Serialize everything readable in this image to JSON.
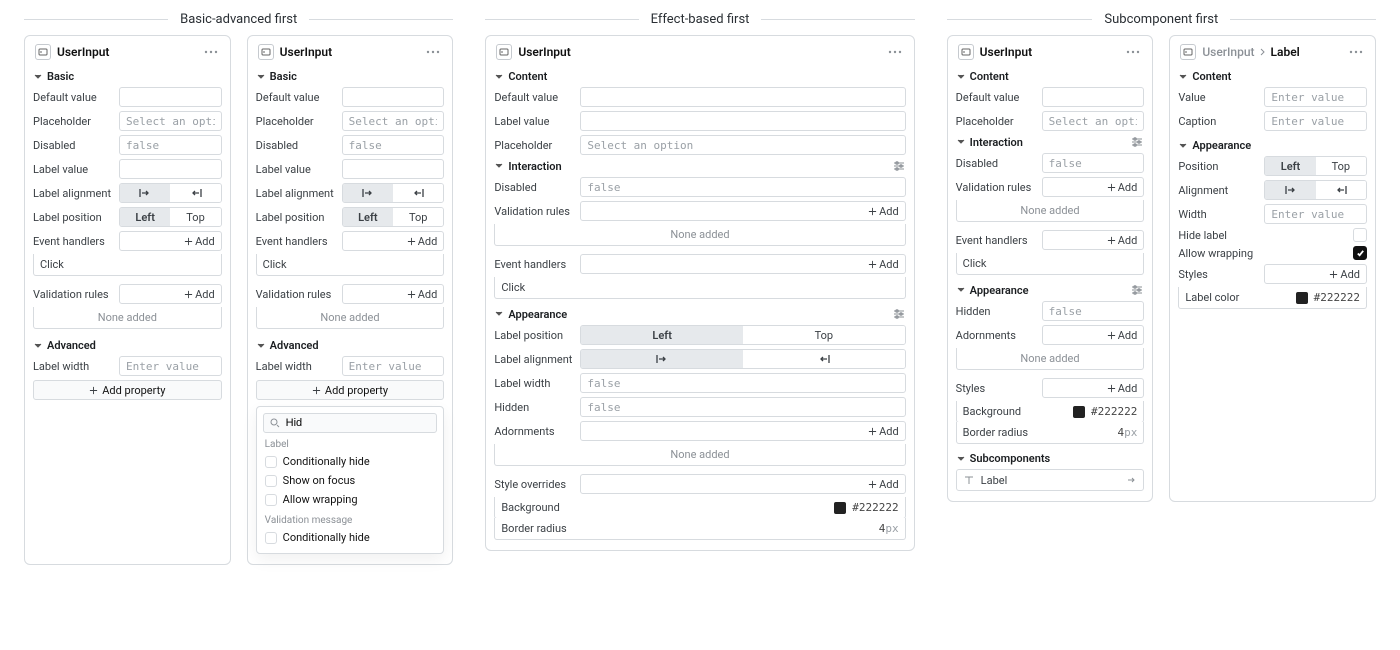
{
  "columns": {
    "basic_advanced": {
      "title": "Basic-advanced first"
    },
    "effect_based": {
      "title": "Effect-based first"
    },
    "subcomponent": {
      "title": "Subcomponent first"
    }
  },
  "labels": {
    "user_input": "UserInput",
    "label_crumb": "Label",
    "basic": "Basic",
    "content": "Content",
    "interaction": "Interaction",
    "appearance": "Appearance",
    "advanced": "Advanced",
    "subcomponents": "Subcomponents",
    "default_value": "Default value",
    "placeholder": "Placeholder",
    "disabled": "Disabled",
    "label_value": "Label value",
    "label_alignment": "Label alignment",
    "label_position": "Label position",
    "label_width": "Label width",
    "event_handlers": "Event handlers",
    "validation_rules": "Validation rules",
    "hidden": "Hidden",
    "adornments": "Adornments",
    "styles": "Styles",
    "style_overrides": "Style overrides",
    "background": "Background",
    "border_radius": "Border radius",
    "width": "Width",
    "position": "Position",
    "alignment": "Alignment",
    "hide_label": "Hide label",
    "allow_wrapping": "Allow wrapping",
    "value": "Value",
    "caption": "Caption",
    "label_color": "Label color",
    "click": "Click",
    "none_added": "None added",
    "add": "Add",
    "add_property": "Add property",
    "left": "Left",
    "top": "Top"
  },
  "placeholders": {
    "select_option": "Select an option",
    "false": "false",
    "enter_value": "Enter value"
  },
  "colors": {
    "swatch_hex": "#222222"
  },
  "values": {
    "border_radius": "4",
    "border_radius_unit": "px"
  },
  "popover": {
    "search_value": "Hid",
    "group_label": "Label",
    "items": [
      "Conditionally hide",
      "Show on focus",
      "Allow wrapping"
    ],
    "group_validation": "Validation message",
    "item_validation": "Conditionally hide"
  },
  "subcomponent_row": {
    "label": "Label"
  }
}
